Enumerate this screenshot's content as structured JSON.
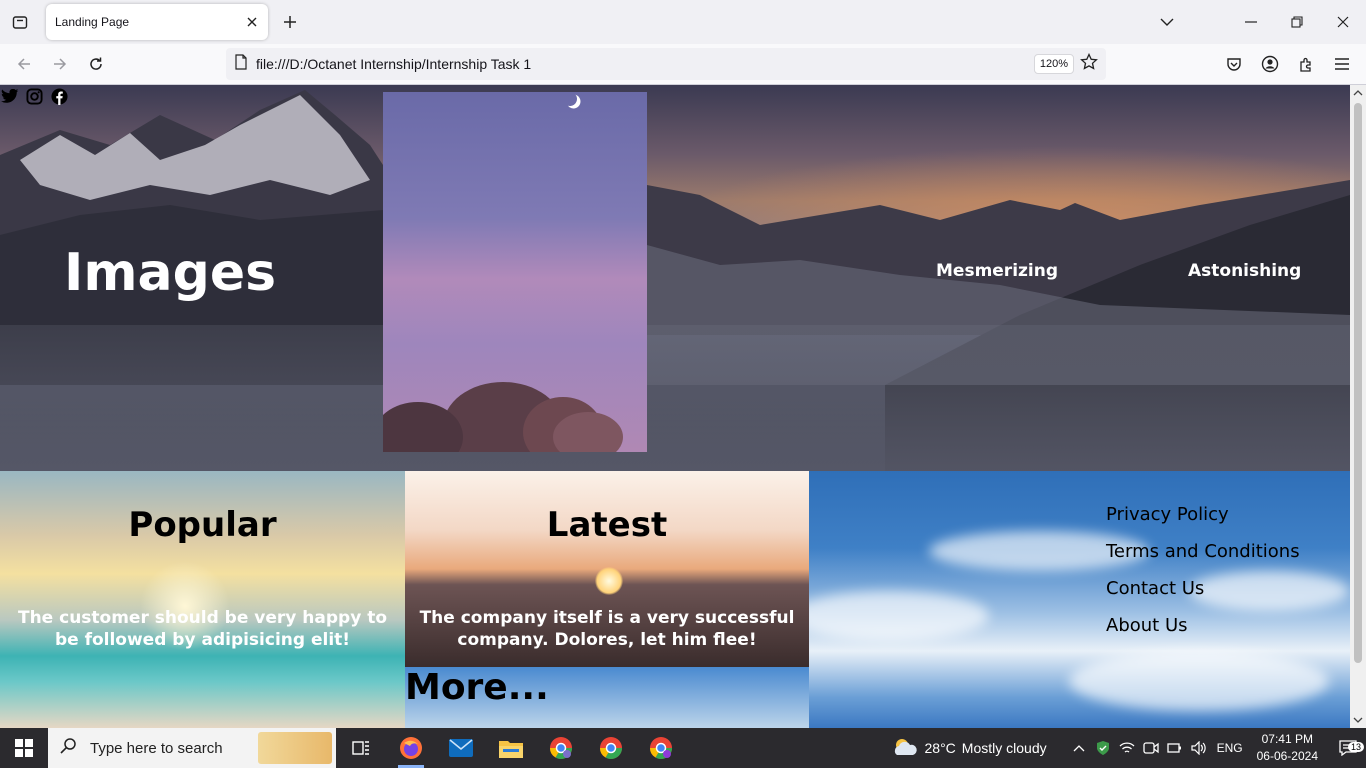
{
  "browser": {
    "tab_title": "Landing Page",
    "url": "file:///D:/Octanet Internship/Internship Task 1",
    "zoom": "120%"
  },
  "hero": {
    "title": "Images",
    "links": [
      "Mesmerizing",
      "Astonishing"
    ],
    "social_icons": [
      "twitter-icon",
      "instagram-icon",
      "facebook-icon"
    ]
  },
  "tiles": {
    "popular": {
      "heading": "Popular",
      "text": "The customer should be very happy to be followed by adipisicing elit!"
    },
    "latest": {
      "heading": "Latest",
      "text": "The company itself is a very successful company. Dolores, let him flee!"
    },
    "more": "More..."
  },
  "footer_links": [
    "Privacy Policy",
    "Terms and Conditions",
    "Contact Us",
    "About Us"
  ],
  "taskbar": {
    "search_placeholder": "Type here to search",
    "weather_temp": "28°C",
    "weather_desc": "Mostly cloudy",
    "lang": "ENG",
    "time": "07:41 PM",
    "date": "06-06-2024",
    "notifications": "13"
  }
}
